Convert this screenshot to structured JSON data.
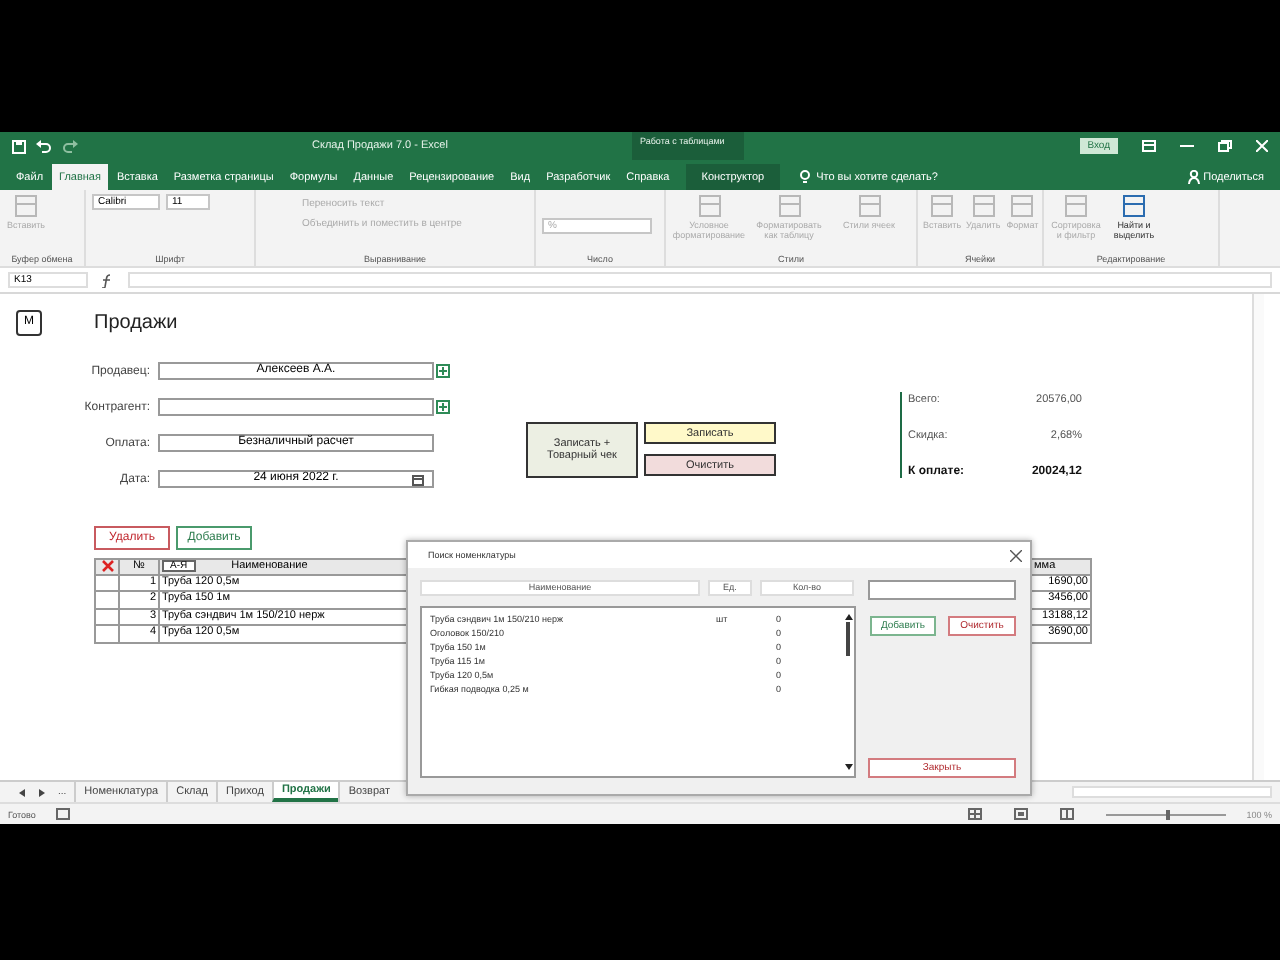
{
  "title_bar": {
    "title": "Склад Продажи 7.0  -  Excel",
    "context_label": "Работа с таблицами",
    "sign_in": "Вход"
  },
  "ribbon_tabs": [
    {
      "label": "Файл",
      "selected": false
    },
    {
      "label": "Главная",
      "selected": true
    },
    {
      "label": "Вставка",
      "selected": false
    },
    {
      "label": "Разметка страницы",
      "selected": false
    },
    {
      "label": "Формулы",
      "selected": false
    },
    {
      "label": "Данные",
      "selected": false
    },
    {
      "label": "Рецензирование",
      "selected": false
    },
    {
      "label": "Вид",
      "selected": false
    },
    {
      "label": "Разработчик",
      "selected": false
    },
    {
      "label": "Справка",
      "selected": false
    },
    {
      "label": "Конструктор",
      "selected": false
    }
  ],
  "tell_me": "Что вы хотите сделать?",
  "share": "Поделиться",
  "ribbon_groups": [
    {
      "label": "Буфер обмена",
      "items": [
        {
          "kind": "large",
          "text": "Вставить",
          "disabled": true
        }
      ]
    },
    {
      "label": "Шрифт",
      "items": [
        {
          "kind": "combo",
          "text": "Calibri",
          "disabled": false
        },
        {
          "kind": "combo",
          "text": "11",
          "disabled": false
        }
      ]
    },
    {
      "label": "Выравнивание",
      "items": [
        {
          "kind": "small",
          "text": "Переносить текст",
          "disabled": true
        },
        {
          "kind": "small",
          "text": "Объединить и поместить в центре",
          "disabled": true
        }
      ]
    },
    {
      "label": "Число",
      "items": [
        {
          "kind": "combo",
          "text": "%",
          "disabled": true
        }
      ]
    },
    {
      "label": "Стили",
      "items": [
        {
          "kind": "large",
          "text": "Условное форматирование",
          "disabled": true
        },
        {
          "kind": "large",
          "text": "Форматировать как таблицу",
          "disabled": true
        },
        {
          "kind": "large",
          "text": "Стили ячеек",
          "disabled": true
        }
      ]
    },
    {
      "label": "Ячейки",
      "items": [
        {
          "kind": "large",
          "text": "Вставить",
          "disabled": true
        },
        {
          "kind": "large",
          "text": "Удалить",
          "disabled": true
        },
        {
          "kind": "large",
          "text": "Формат",
          "disabled": true
        }
      ]
    },
    {
      "label": "Редактирование",
      "items": [
        {
          "kind": "large",
          "text": "Сортировка и фильтр",
          "disabled": true
        },
        {
          "kind": "large",
          "text": "Найти и выделить",
          "disabled": false
        }
      ]
    }
  ],
  "formula_bar": {
    "name_box": "K13"
  },
  "form": {
    "badge": "M",
    "title": "Продажи",
    "fields": [
      {
        "label": "Продавец:",
        "value": "Алексеев А.А.",
        "kind": "add"
      },
      {
        "label": "Контрагент:",
        "kind": "add"
      },
      {
        "label": "Оплата:",
        "value": "Безналичный расчет",
        "kind": "plain"
      },
      {
        "label": "Дата:",
        "value": "24 июня 2022 г.",
        "kind": "date"
      }
    ],
    "actions": [
      {
        "label": "Записать +\nТоварный чек",
        "kind": "big"
      },
      {
        "label": "Записать",
        "kind": "save"
      },
      {
        "label": "Очистить",
        "kind": "clear"
      }
    ],
    "totals": [
      {
        "label": "Всего:",
        "value": "20576,00",
        "bold": false
      },
      {
        "label": "Скидка:",
        "value": "2,68%",
        "bold": false
      },
      {
        "label": "К оплате:",
        "value": "20024,12",
        "bold": true
      }
    ]
  },
  "table_buttons": [
    {
      "label": "Удалить",
      "kind": "danger"
    },
    {
      "label": "Добавить",
      "kind": "ok"
    }
  ],
  "table": {
    "columns": [
      "№",
      "А-Я",
      "Наименование",
      "мма"
    ],
    "rows": [
      {
        "no": "1",
        "name": "Труба 120 0,5м",
        "column_4": "1690,00"
      },
      {
        "no": "2",
        "name": "Труба 150 1м",
        "column_4": "3456,00"
      },
      {
        "no": "3",
        "name": "Труба сэндвич 1м 150/210 нерж",
        "column_4": "13188,12"
      },
      {
        "no": "4",
        "name": "Труба 120 0,5м",
        "column_4": "3690,00"
      }
    ]
  },
  "dialog": {
    "title": "Поиск номенклатуры",
    "columns": [
      "Наименование",
      "Ед.",
      "Кол-во"
    ],
    "rows": [
      {
        "name": "Труба сэндвич 1м 150/210 нерж",
        "unit": "шт",
        "qty": "0"
      },
      {
        "name": "Оголовок 150/210",
        "qty": "0"
      },
      {
        "name": "Труба 150 1м",
        "qty": "0"
      },
      {
        "name": "Труба 115 1м",
        "qty": "0"
      },
      {
        "name": "Труба 120 0,5м",
        "qty": "0"
      },
      {
        "name": "Гибкая подводка 0,25 м",
        "qty": "0"
      }
    ],
    "buttons": [
      {
        "label": "Добавить",
        "kind": "ok"
      },
      {
        "label": "Очистить",
        "kind": "danger"
      },
      {
        "label": "Закрыть",
        "kind": "close"
      }
    ]
  },
  "sheet_nav": "...",
  "sheet_tabs": [
    {
      "label": "Номенклатура",
      "selected": false
    },
    {
      "label": "Склад",
      "selected": false
    },
    {
      "label": "Приход",
      "selected": false
    },
    {
      "label": "Продажи",
      "selected": true
    },
    {
      "label": "Возврат",
      "selected": false
    }
  ],
  "status_bar": {
    "ready": "Готово",
    "zoom_slider": {
      "level": 0.5
    },
    "zoom": "100 %"
  }
}
